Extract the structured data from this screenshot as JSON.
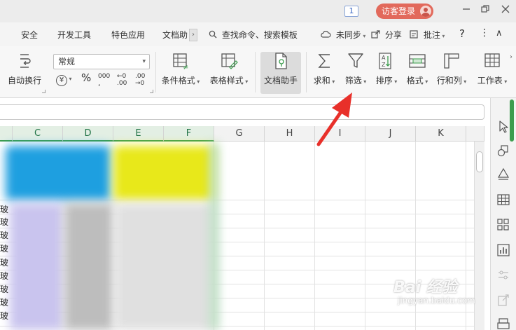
{
  "titlebar": {
    "page_badge": "1",
    "visitor_login": "访客登录",
    "controls": [
      "minimize-icon",
      "restore-icon",
      "close-icon"
    ]
  },
  "menu": {
    "tabs": [
      "安全",
      "开发工具",
      "特色应用",
      "文档助"
    ],
    "search": "查找命令、搜索模板",
    "sync": "未同步",
    "share": "分享",
    "comment": "批注",
    "help": "?",
    "more": "⋮",
    "collapse": "∧"
  },
  "ribbon": {
    "wrap_text": "自动换行",
    "number_format": "常规",
    "currency_symbol": "¥",
    "percent_symbol": "%",
    "thousands_symbol": "000",
    "inc_decimal": "←0 .00",
    "dec_decimal": ".00 →0",
    "conditional_format": "条件格式",
    "table_style": "表格样式",
    "doc_helper": "文档助手",
    "sum": "求和",
    "filter": "筛选",
    "sort": "排序",
    "format": "格式",
    "row_col": "行和列",
    "worksheet": "工作表"
  },
  "grid": {
    "columns": [
      "C",
      "D",
      "E",
      "F",
      "G",
      "H",
      "I",
      "J",
      "K"
    ],
    "selected_columns": [
      "C",
      "D",
      "E",
      "F"
    ],
    "row_edge_text": [
      "玻",
      "玻",
      "玻",
      "玻",
      "玻",
      "玻",
      "玻",
      "玻",
      "玻"
    ]
  },
  "watermark": {
    "main": "Bai 经验",
    "sub": "jingyan.baidu.com"
  },
  "colors": {
    "accent_green": "#3C9D4E",
    "visitor_red": "#E2695B",
    "annotation_red": "#E8302A",
    "blur_blue": "#1E9FE0",
    "blur_yellow": "#E8E81A",
    "blur_purple": "#C9C4EE"
  }
}
